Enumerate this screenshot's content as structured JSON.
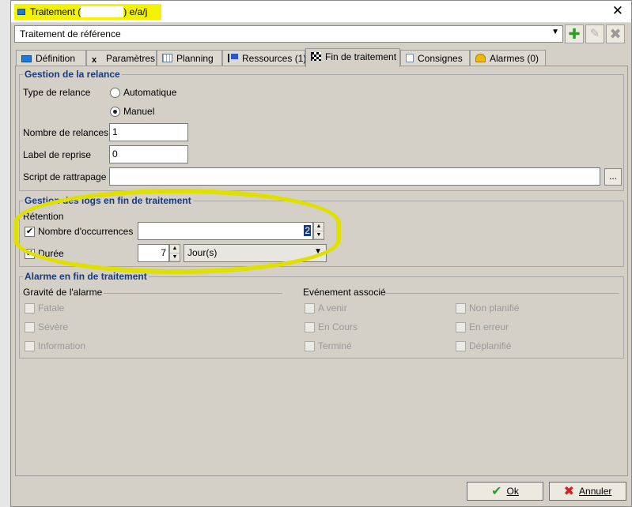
{
  "window": {
    "title_prefix": "Traitement (",
    "title_suffix": ") e/a/j",
    "close_icon": "✕"
  },
  "toolbar": {
    "reference_select": "Traitement de référence",
    "add_icon": "✚",
    "edit_icon": "✎",
    "delete_icon": "✖"
  },
  "tabs": [
    {
      "label": "Définition",
      "icon": "window-icon"
    },
    {
      "label": "Paramètres",
      "icon": "x-icon"
    },
    {
      "label": "Planning",
      "icon": "calendar-icon"
    },
    {
      "label": "Ressources (1)",
      "icon": "flag-icon"
    },
    {
      "label": "Fin de traitement",
      "icon": "checkered-flag-icon",
      "active": true
    },
    {
      "label": "Consignes",
      "icon": "document-icon"
    },
    {
      "label": "Alarmes (0)",
      "icon": "bell-icon"
    }
  ],
  "relance": {
    "title": "Gestion de la relance",
    "type_label": "Type de relance",
    "option_auto": "Automatique",
    "option_manuel": "Manuel",
    "selected": "Manuel",
    "nb_relances_label": "Nombre de relances",
    "nb_relances_value": "1",
    "label_reprise_label": "Label de reprise",
    "label_reprise_value": "0",
    "script_label": "Script de rattrapage",
    "script_value": "",
    "browse_label": "..."
  },
  "logs": {
    "title": "Gestion des logs en fin de traitement",
    "retention_label": "Rétention",
    "occ_label": "Nombre d'occurrences",
    "occ_checked": true,
    "occ_value": "2",
    "duree_label": "Durée",
    "duree_checked": true,
    "duree_value": "7",
    "duree_unit": "Jour(s)"
  },
  "alarme": {
    "title": "Alarme en fin de traitement",
    "gravite_label": "Gravité de l'alarme",
    "evenement_label": "Evénement associé",
    "gravite": [
      "Fatale",
      "Sévère",
      "Information"
    ],
    "evenement_col1": [
      "A venir",
      "En Cours",
      "Terminé"
    ],
    "evenement_col2": [
      "Non planifié",
      "En erreur",
      "Déplanifié"
    ]
  },
  "buttons": {
    "ok": "Ok",
    "annuler": "Annuler"
  },
  "colors": {
    "highlight": "#e0e000",
    "group_title": "#1a3a7a",
    "ok_check": "#2aa02a",
    "cancel_x": "#d02020",
    "add_green": "#2aa02a"
  }
}
